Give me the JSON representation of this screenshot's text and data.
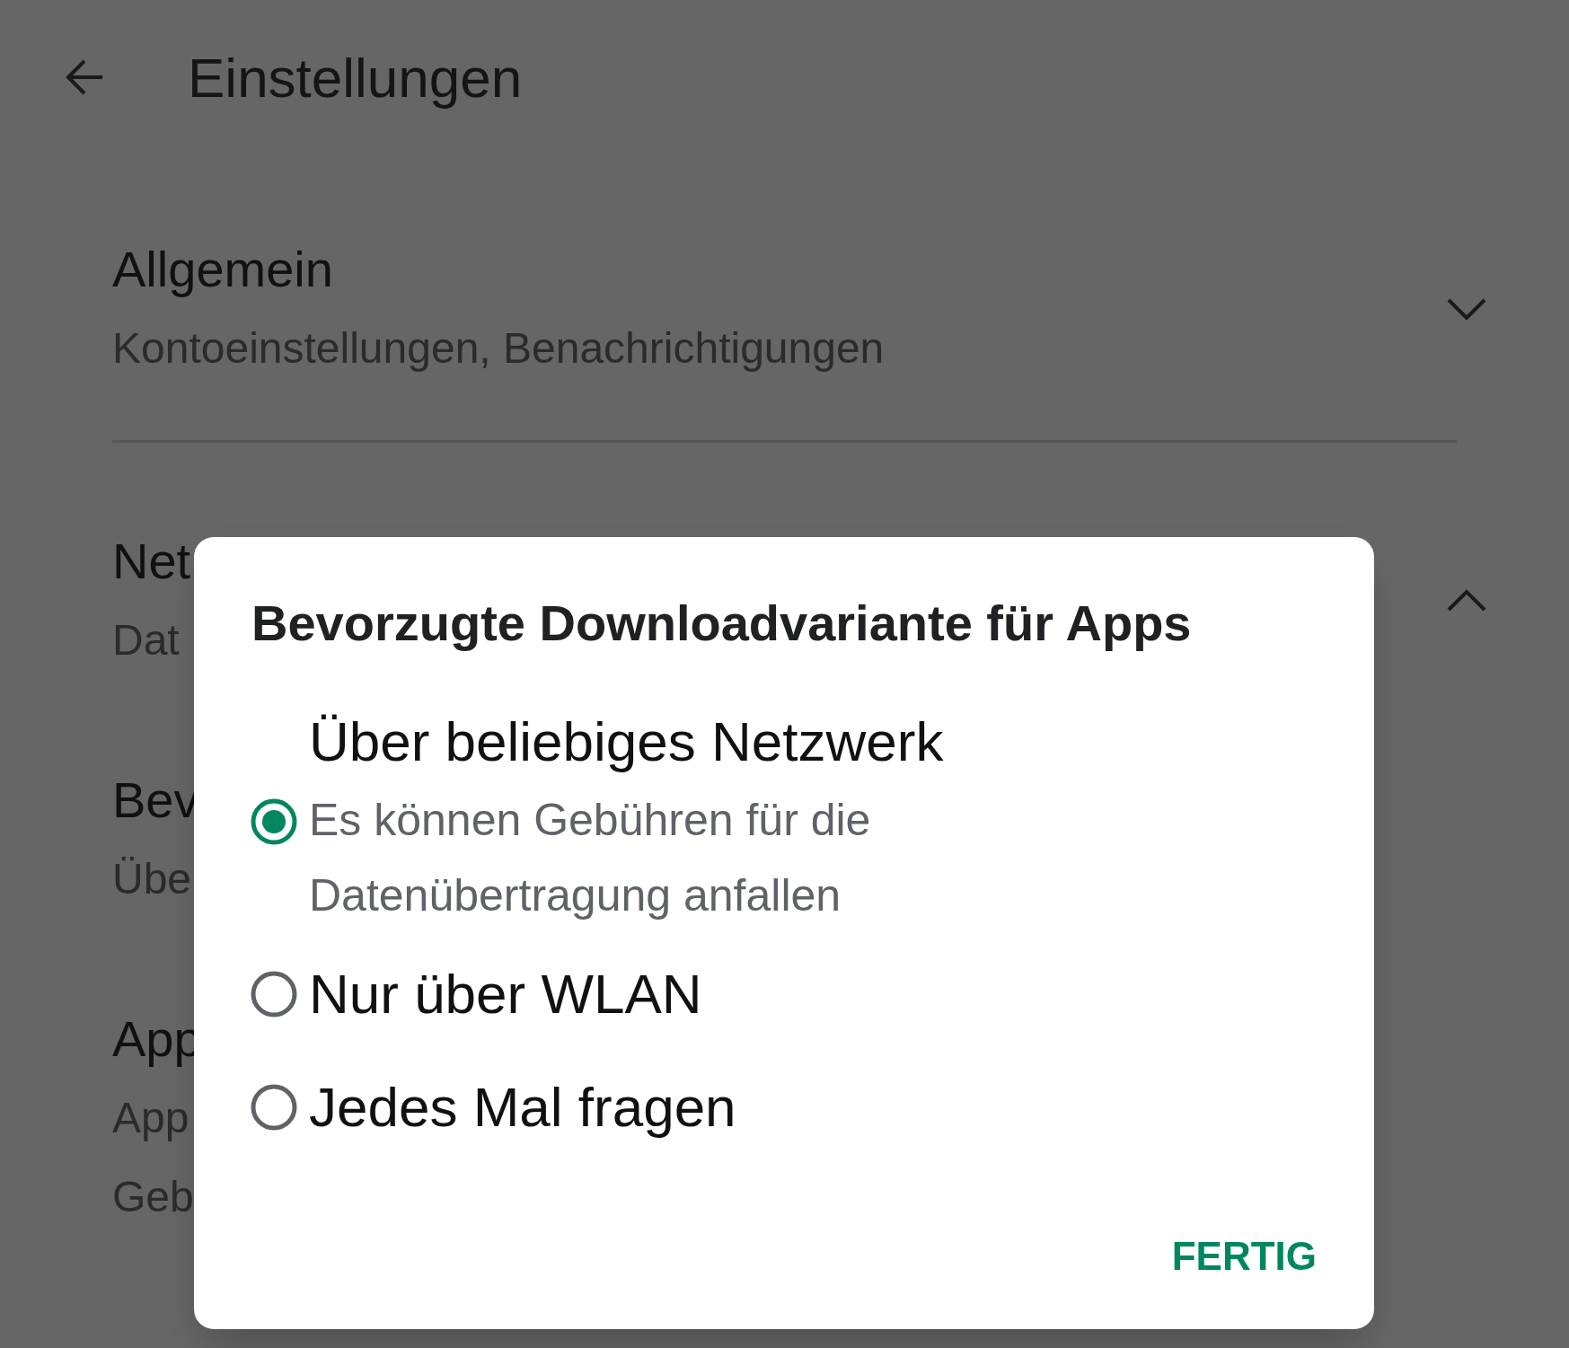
{
  "header": {
    "title": "Einstellungen"
  },
  "sections": [
    {
      "title": "Allgemein",
      "subtitle_lines": [
        "Kontoeinstellungen, Benachrichtigungen"
      ],
      "expanded": false
    },
    {
      "title": "Net",
      "subtitle_lines": [
        "Dat"
      ],
      "expanded": true
    }
  ],
  "settings": [
    {
      "title": "Bev",
      "subtitle_lines": [
        "Übe"
      ]
    },
    {
      "title": "App",
      "subtitle_lines": [
        "App",
        "Geb"
      ]
    }
  ],
  "dialog": {
    "title": "Bevorzugte Downloadvariante für Apps",
    "options": [
      {
        "label": "Über beliebiges Netzwerk",
        "description": "Es können Gebühren für die Datenübertragung anfallen",
        "selected": true
      },
      {
        "label": "Nur über WLAN",
        "selected": false
      },
      {
        "label": "Jedes Mal fragen",
        "selected": false
      }
    ],
    "button": "FERTIG"
  }
}
